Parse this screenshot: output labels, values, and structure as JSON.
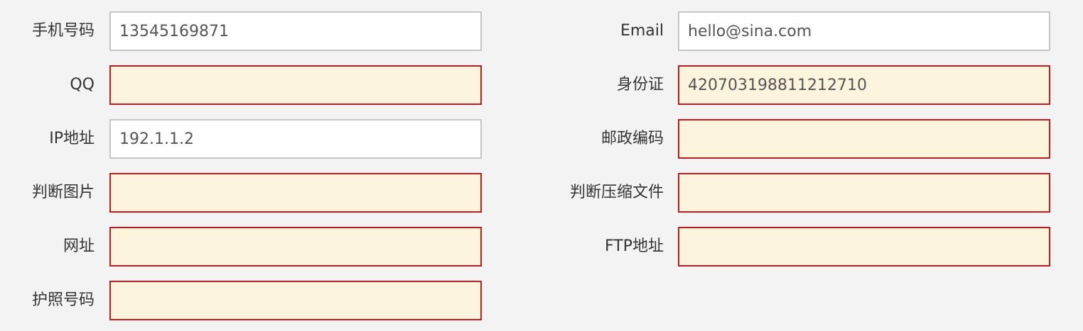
{
  "form": {
    "mobile": {
      "label": "手机号码",
      "value": "13545169871",
      "invalid": false
    },
    "email": {
      "label": "Email",
      "value": "hello@sina.com",
      "invalid": false
    },
    "qq": {
      "label": "QQ",
      "value": "",
      "invalid": true
    },
    "id_card": {
      "label": "身份证",
      "value": "420703198811212710",
      "invalid": true
    },
    "ip": {
      "label": "IP地址",
      "value": "192.1.1.2",
      "invalid": false
    },
    "postal_code": {
      "label": "邮政编码",
      "value": "",
      "invalid": true
    },
    "image_check": {
      "label": "判断图片",
      "value": "",
      "invalid": true
    },
    "archive_check": {
      "label": "判断压缩文件",
      "value": "",
      "invalid": true
    },
    "url": {
      "label": "网址",
      "value": "",
      "invalid": true
    },
    "ftp": {
      "label": "FTP地址",
      "value": "",
      "invalid": true
    },
    "passport": {
      "label": "护照号码",
      "value": "",
      "invalid": true
    }
  },
  "colors": {
    "background": "#f3f3f3",
    "valid_border": "#c6c6c6",
    "valid_fill": "#ffffff",
    "error_border": "#c01e1e",
    "error_fill": "#fcf4dc"
  }
}
